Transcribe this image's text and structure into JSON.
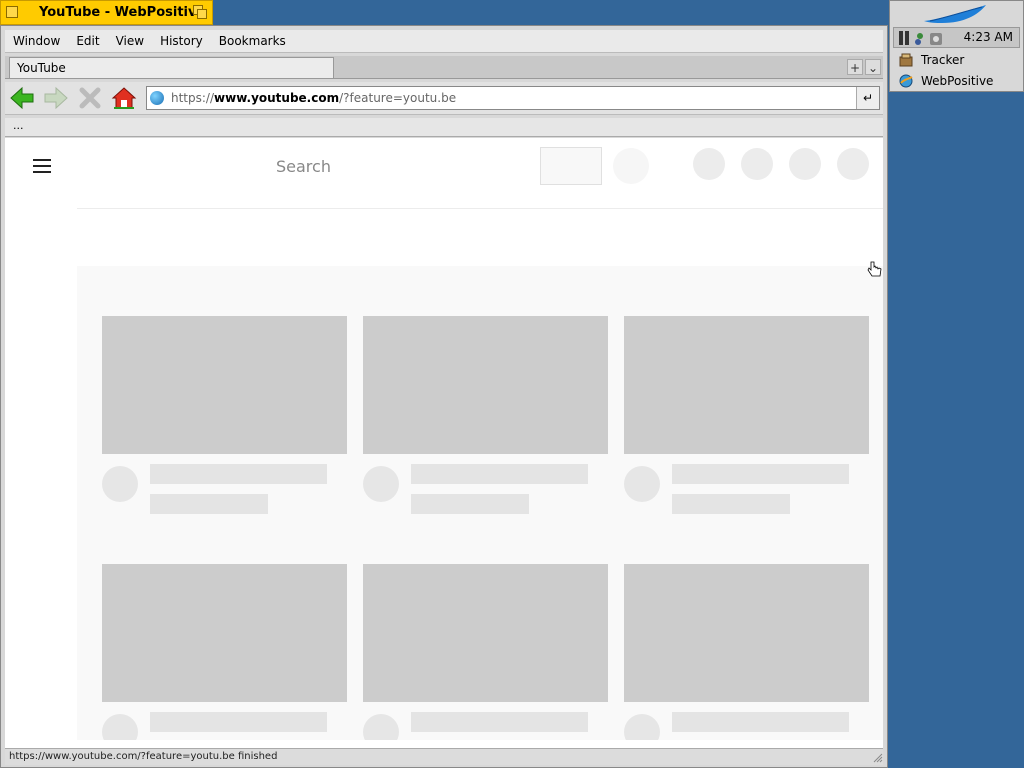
{
  "window": {
    "title": "YouTube - WebPositive"
  },
  "menu": [
    "Window",
    "Edit",
    "View",
    "History",
    "Bookmarks"
  ],
  "tabs": [
    {
      "label": "YouTube",
      "active": true
    }
  ],
  "tab_controls": {
    "new_tab": "+",
    "tab_menu": "⌄"
  },
  "address": {
    "scheme": "https://",
    "host": "www.youtube.com",
    "path": "/?feature=youtu.be",
    "go": "↵"
  },
  "bookmarks_bar": {
    "overflow": "..."
  },
  "page": {
    "search_placeholder": "Search"
  },
  "status": {
    "text": "https://www.youtube.com/?feature=youtu.be finished"
  },
  "deskbar": {
    "clock": "4:23 AM",
    "apps": [
      {
        "label": "Tracker",
        "icon": "tracker-icon"
      },
      {
        "label": "WebPositive",
        "icon": "webpositive-icon"
      }
    ]
  },
  "colors": {
    "desktop": "#336699",
    "title_tab": "#ffcb00",
    "skeleton": "#cccccc"
  }
}
